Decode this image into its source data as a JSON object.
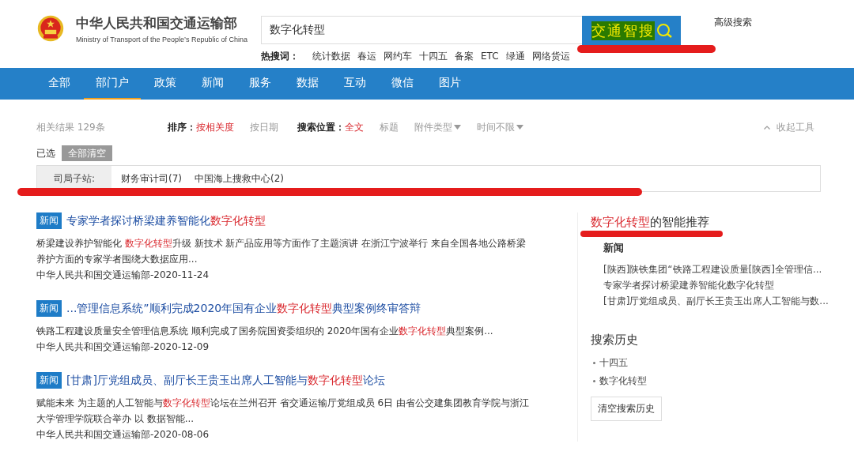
{
  "header": {
    "title": "中华人民共和国交通运输部",
    "subtitle": "Ministry of Transport of the People’s Republic of China"
  },
  "search": {
    "value": "数字化转型",
    "button": "交通智搜",
    "advanced": "高级搜索",
    "hot_label": "热搜词：",
    "hot_words": [
      "统计数据",
      "春运",
      "网约车",
      "十四五",
      "备案",
      "ETC",
      "绿通",
      "网络货运"
    ]
  },
  "nav": [
    {
      "label": "全部",
      "selected": false
    },
    {
      "label": "部门户",
      "selected": true
    },
    {
      "label": "政策",
      "selected": false
    },
    {
      "label": "新闻",
      "selected": false
    },
    {
      "label": "服务",
      "selected": false
    },
    {
      "label": "数据",
      "selected": false
    },
    {
      "label": "互动",
      "selected": false
    },
    {
      "label": "微信",
      "selected": false
    },
    {
      "label": "图片",
      "selected": false
    }
  ],
  "toolbar": {
    "result_count": "相关结果 129条",
    "sort_label": "排序：",
    "sort_options": [
      {
        "label": "按相关度",
        "selected": true
      },
      {
        "label": "按日期",
        "selected": false
      }
    ],
    "location_label": "搜索位置：",
    "location_options": [
      {
        "label": "全文",
        "selected": true,
        "kind": "option"
      },
      {
        "label": "标题",
        "selected": false,
        "kind": "option"
      },
      {
        "label": "附件类型",
        "selected": false,
        "kind": "dropdown"
      },
      {
        "label": "时间不限",
        "selected": false,
        "kind": "dropdown"
      }
    ],
    "collapse": "收起工具"
  },
  "selected_filters": {
    "label": "已选",
    "clear": "全部清空"
  },
  "subsite_filter": {
    "label": "司局子站:",
    "options": [
      "财务审计司(7)",
      "中国海上搜救中心(2)"
    ]
  },
  "results": [
    {
      "tag": "新闻",
      "title": [
        {
          "text": "专家学者探讨桥梁建养智能化",
          "highlight": false
        },
        {
          "text": "数字化转型",
          "highlight": true
        }
      ],
      "snippet": [
        {
          "text": "桥梁建设养护智能化 ",
          "highlight": false
        },
        {
          "text": "数字化转型",
          "highlight": true
        },
        {
          "text": "升级 新技术 新产品应用等方面作了主题演讲 在浙江宁波举行 来自全国各地公路桥梁养护方面的专家学者围绕大数据应用...",
          "highlight": false
        }
      ],
      "source": "中华人民共和国交通运输部-2020-11-24"
    },
    {
      "tag": "新闻",
      "title": [
        {
          "text": "...管理信息系统”顺利完成2020年国有企业",
          "highlight": false
        },
        {
          "text": "数字化转型",
          "highlight": true
        },
        {
          "text": "典型案例终审答辩",
          "highlight": false
        }
      ],
      "snippet": [
        {
          "text": "铁路工程建设质量安全管理信息系统 顺利完成了国务院国资委组织的 2020年国有企业",
          "highlight": false
        },
        {
          "text": "数字化转型",
          "highlight": true
        },
        {
          "text": "典型案例...",
          "highlight": false
        }
      ],
      "source": "中华人民共和国交通运输部-2020-12-09"
    },
    {
      "tag": "新闻",
      "title": [
        {
          "text": "[甘肃]厅党组成员、副厅长王贵玉出席人工智能与",
          "highlight": false
        },
        {
          "text": "数字化转型",
          "highlight": true
        },
        {
          "text": "论坛",
          "highlight": false
        }
      ],
      "snippet": [
        {
          "text": "赋能未来 为主题的人工智能与",
          "highlight": false
        },
        {
          "text": "数字化转型",
          "highlight": true
        },
        {
          "text": "论坛在兰州召开 省交通运输厅党组成员 6日 由省公交建集团教育学院与浙江大学管理学院联合举办 以 数据智能...",
          "highlight": false
        }
      ],
      "source": "中华人民共和国交通运输部-2020-08-06"
    }
  ],
  "sidebar": {
    "recommend_title": [
      {
        "text": "数字化转型",
        "highlight": true
      },
      {
        "text": "的智能推荐",
        "highlight": false
      }
    ],
    "recommend_category": "新闻",
    "recommend_items": [
      "[陕西]陕铁集团“铁路工程建设质量[陕西]全管理信...",
      "专家学者探讨桥梁建养智能化数字化转型",
      "[甘肃]厅党组成员、副厅长王贵玉出席人工智能与数..."
    ],
    "history_title": "搜索历史",
    "history_items": [
      "十四五",
      "数字化转型"
    ],
    "clear_history": "清空搜索历史"
  }
}
